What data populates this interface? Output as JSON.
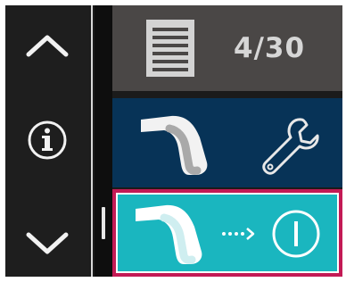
{
  "left_controls": {
    "up_icon": "chevron-up-icon",
    "info_icon": "info-icon",
    "down_icon": "chevron-down-icon"
  },
  "header": {
    "icon": "document-icon",
    "page_counter": "4/30"
  },
  "items": [
    {
      "icon": "tube-icon",
      "action_icon": "wrench-icon",
      "selected": false
    },
    {
      "icon": "tube-icon",
      "action_icon": "power-icon",
      "indicator": "dotted-arrow-icon",
      "selected": true
    }
  ],
  "colors": {
    "header_bg": "#4a4746",
    "item_dark_bg": "#073357",
    "item_selected_bg": "#1ab6bf",
    "selected_border": "#c31a55"
  }
}
